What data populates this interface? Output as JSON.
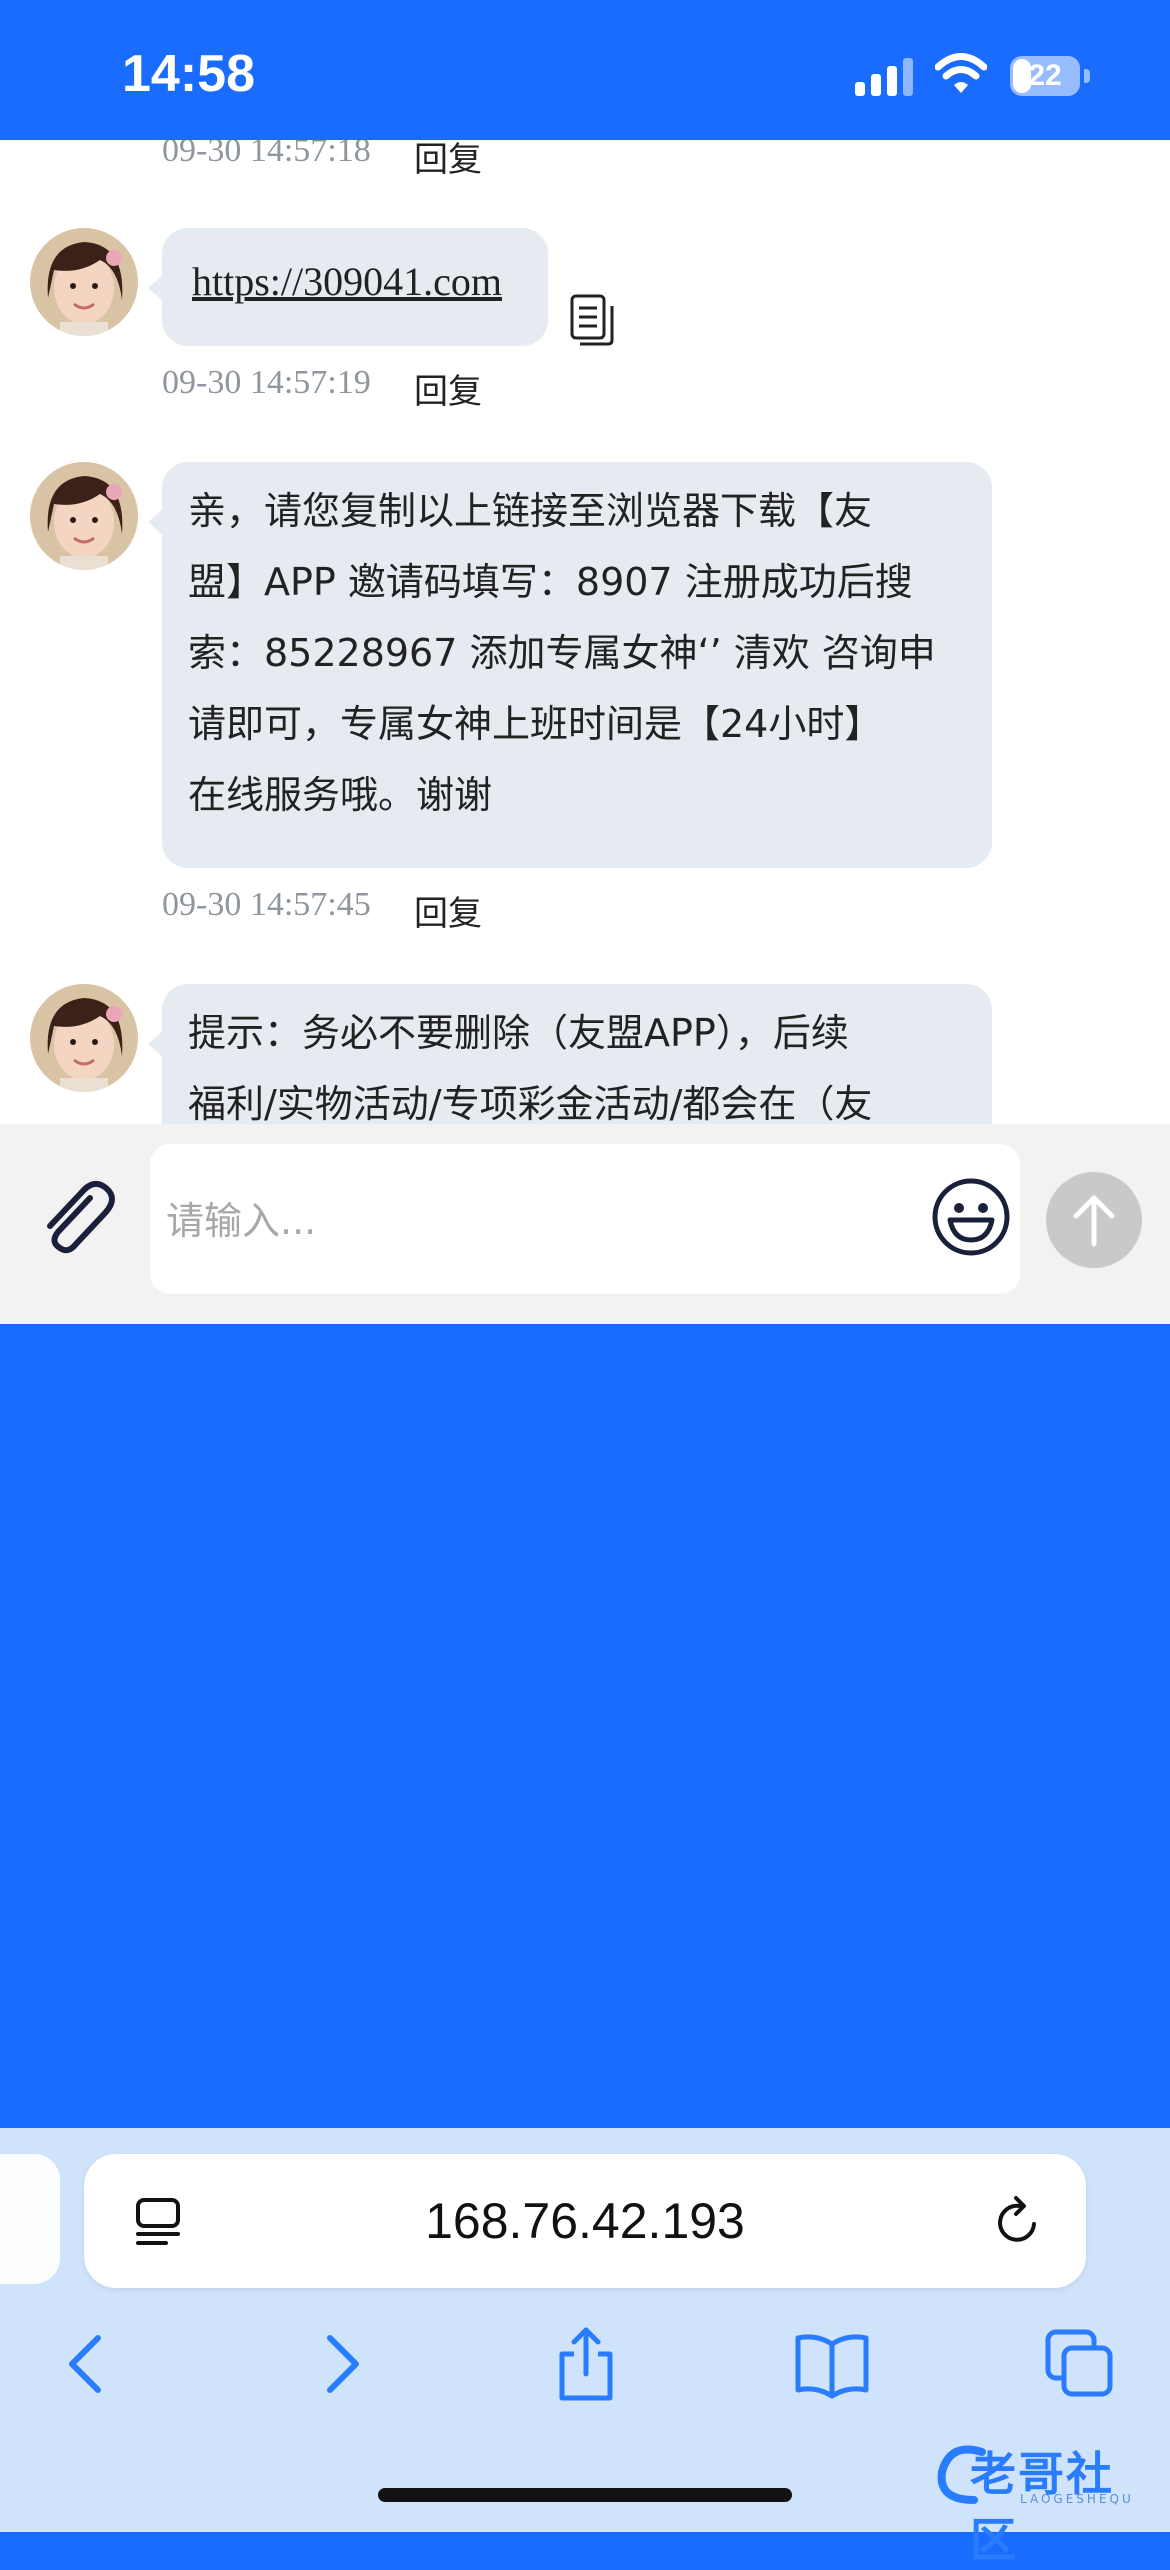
{
  "status_bar": {
    "time": "14:58",
    "battery": "22"
  },
  "messages": [
    {
      "meta": "09-30 14:57:18",
      "reply": "回复"
    },
    {
      "text": "https://309041.com",
      "meta": "09-30 14:57:19",
      "reply": "回复",
      "is_link": true
    },
    {
      "lines": [
        "亲，请您复制以上链接至浏览器下载【友",
        "盟】APP 邀请码填写：8907 注册成功后搜",
        "索：85228967 添加专属女神‘’ 清欢 咨询申",
        "请即可，专属女神上班时间是【24小时】",
        "在线服务哦。谢谢"
      ],
      "meta": "09-30 14:57:45",
      "reply": "回复"
    },
    {
      "lines": [
        "提示：务必不要删除（友盟APP），后续",
        "福利/实物活动/专项彩金活动/都会在（友"
      ]
    }
  ],
  "input": {
    "placeholder": "请输入..."
  },
  "browser": {
    "url": "168.76.42.193"
  },
  "watermark": {
    "text": "老哥社区",
    "sub": "LAOGESHEQU"
  },
  "colors": {
    "accent": "#1a6cff",
    "bubble": "#e6eaf1",
    "toolbar": "#cfe3fb"
  },
  "icons": [
    "signal-icon",
    "wifi-icon",
    "battery-icon",
    "copy-icon",
    "attach-icon",
    "emoji-icon",
    "send-icon",
    "reader-icon",
    "reload-icon",
    "back-icon",
    "forward-icon",
    "share-icon",
    "bookmarks-icon",
    "tabs-icon"
  ]
}
